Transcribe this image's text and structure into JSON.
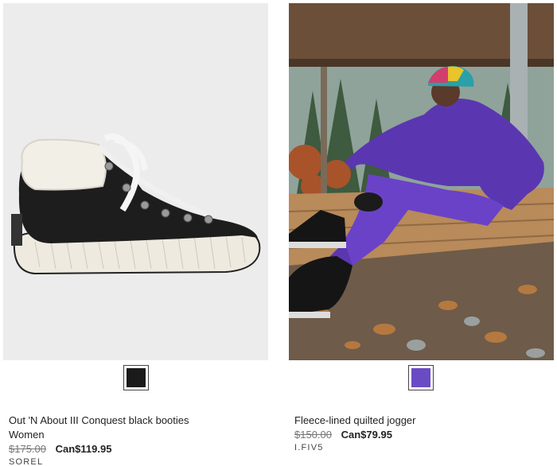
{
  "products": [
    {
      "name": "Out 'N About III Conquest black booties",
      "category": "Women",
      "price_original": "$175.00",
      "price_sale": "Can$119.95",
      "brand": "SOREL",
      "swatch_color": "#1a1a1a",
      "image_icon": "black-sneaker-bootie-image"
    },
    {
      "name": "Fleece-lined quilted jogger",
      "price_original": "$150.00",
      "price_sale": "Can$79.95",
      "brand": "I.FIV5",
      "swatch_color": "#6a4bc4",
      "image_icon": "model-purple-snowsuit-image"
    }
  ]
}
